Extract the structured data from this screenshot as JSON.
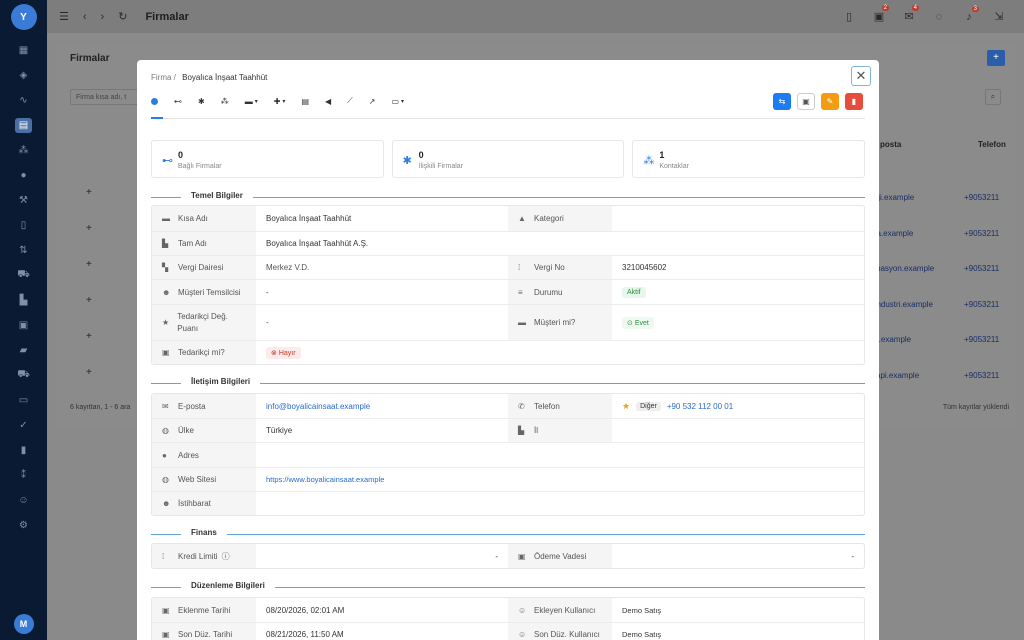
{
  "sidebar": {
    "avatar": "Y",
    "avatar_bottom": "M"
  },
  "topbar": {
    "title": "Firmalar",
    "badges": [
      "2",
      "4",
      "3"
    ]
  },
  "background": {
    "page_title": "Firmalar",
    "search_placeholder": "Firma kısa adı, t",
    "footer_left": "6 kayıttan, 1 - 6 ara",
    "footer_right": "Tüm kayıtlar yüklendi",
    "col_eposta": "posta",
    "col_telefon": "Telefon",
    "rows": [
      {
        "email": "ieji.example",
        "phone": "+9053211"
      },
      {
        "email": "da.example",
        "phone": "+9053211"
      },
      {
        "email": "imasyon.example",
        "phone": "+9053211"
      },
      {
        "email": "endustri.example",
        "phone": "+9053211"
      },
      {
        "email": "et.example",
        "phone": "+9053211"
      },
      {
        "email": "yapi.example",
        "phone": "+9053211"
      }
    ]
  },
  "modal": {
    "crumb_root": "Firma",
    "crumb_current": "Boyalıca İnşaat Taahhüt",
    "stats": [
      {
        "value": "0",
        "label": "Bağlı Firmalar"
      },
      {
        "value": "0",
        "label": "İlişkili Firmalar"
      },
      {
        "value": "1",
        "label": "Kontaklar"
      }
    ],
    "sections": {
      "temel": "Temel Bilgiler",
      "iletisim": "İletişim Bilgileri",
      "finans": "Finans",
      "duzenleme": "Düzenleme Bilgileri"
    },
    "temel": {
      "kisa_adi_label": "Kısa Adı",
      "kisa_adi": "Boyalıca İnşaat Taahhüt",
      "kategori_label": "Kategori",
      "tam_adi_label": "Tam Adı",
      "tam_adi": "Boyalıca İnşaat Taahhüt A.Ş.",
      "vergi_dairesi_label": "Vergi Dairesi",
      "vergi_dairesi": "Merkez V.D.",
      "vergi_no_label": "Vergi No",
      "vergi_no": "3210045602",
      "temsilci_label": "Müşteri Temsilcisi",
      "temsilci": "-",
      "durum_label": "Durumu",
      "durum": "Aktif",
      "tedarikci_puan_label": "Tedarikçi Değ. Puanı",
      "tedarikci_puan": "-",
      "musteri_mi_label": "Müşteri mi?",
      "musteri_mi": "Evet",
      "tedarikci_mi_label": "Tedarikçi mi?",
      "tedarikci_mi": "Hayır"
    },
    "iletisim": {
      "eposta_label": "E-posta",
      "eposta": "info@boyalicainsaat.example",
      "telefon_label": "Telefon",
      "telefon_tag": "Diğer",
      "telefon": "+90 532 112 00 01",
      "ulke_label": "Ülke",
      "ulke": "Türkiye",
      "il_label": "İl",
      "adres_label": "Adres",
      "web_label": "Web Sitesi",
      "web": "https://www.boyalicainsaat.example",
      "istihbarat_label": "İstihbarat"
    },
    "finans": {
      "kredi_label": "Kredi Limiti",
      "kredi": "-",
      "odeme_label": "Ödeme Vadesi",
      "odeme": "-"
    },
    "duzenleme": {
      "eklenme_label": "Eklenme Tarihi",
      "eklenme": "08/20/2026, 02:01 AM",
      "ekleyen_label": "Ekleyen Kullanıcı",
      "ekleyen": "Demo Satış",
      "sonduz_label": "Son Düz. Tarihi",
      "sonduz": "08/21/2026, 11:50 AM",
      "sonduz_kul_label": "Son Düz. Kullanıcı",
      "sonduz_kul": "Demo Satış"
    }
  }
}
